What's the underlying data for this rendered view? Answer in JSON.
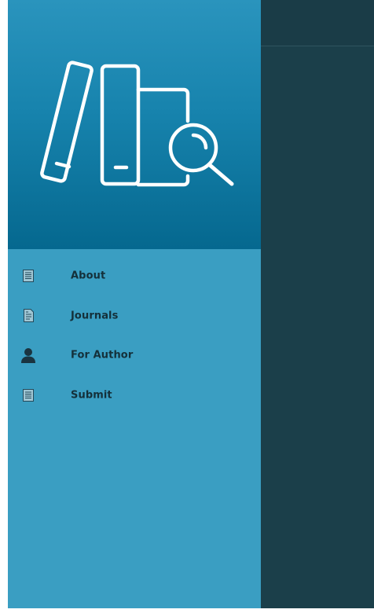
{
  "colors": {
    "drawer_bg": "#3a9ec2",
    "header_top": "#2a94bd",
    "header_bottom": "#05688f",
    "backdrop": "#1b3f4a",
    "label_text": "#14303a",
    "icon_color": "#1a3440"
  },
  "drawer": {
    "logo_icon": "books-search-icon",
    "menu": [
      {
        "label": "About",
        "icon": "document-icon"
      },
      {
        "label": "Journals",
        "icon": "journal-icon"
      },
      {
        "label": "For Author",
        "icon": "person-icon"
      },
      {
        "label": "Submit",
        "icon": "document-icon"
      }
    ]
  }
}
